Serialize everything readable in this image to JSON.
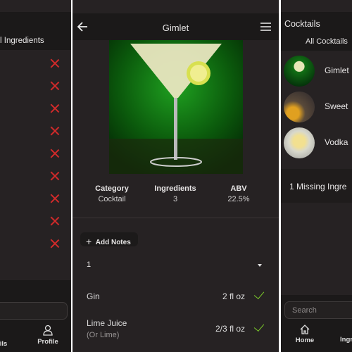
{
  "left_panel": {
    "header_tab": "l Ingredients",
    "remove_count": 9,
    "tabs": [
      "ils",
      "Profile"
    ]
  },
  "detail": {
    "title": "Gimlet",
    "stats": [
      {
        "label": "Category",
        "value": "Cocktail"
      },
      {
        "label": "Ingredients",
        "value": "3"
      },
      {
        "label": "ABV",
        "value": "22.5%"
      }
    ],
    "add_notes": "Add Notes",
    "servings": "1",
    "ingredients": [
      {
        "name": "Gin",
        "note": "",
        "amount": "2 fl oz",
        "available": true
      },
      {
        "name": "Lime Juice",
        "note": "(Or Lime)",
        "amount": "2/3 fl oz",
        "available": true
      }
    ],
    "colors": {
      "check": "#7ccc2a",
      "remove": "#d12a2a"
    }
  },
  "right_panel": {
    "title": "Cocktails",
    "tab": "All Cocktails",
    "items": [
      "Gimlet",
      "Sweet",
      "Vodka"
    ],
    "missing": "1 Missing Ingre",
    "search_placeholder": "Search",
    "tabs": [
      "Home",
      "Ingr"
    ]
  }
}
